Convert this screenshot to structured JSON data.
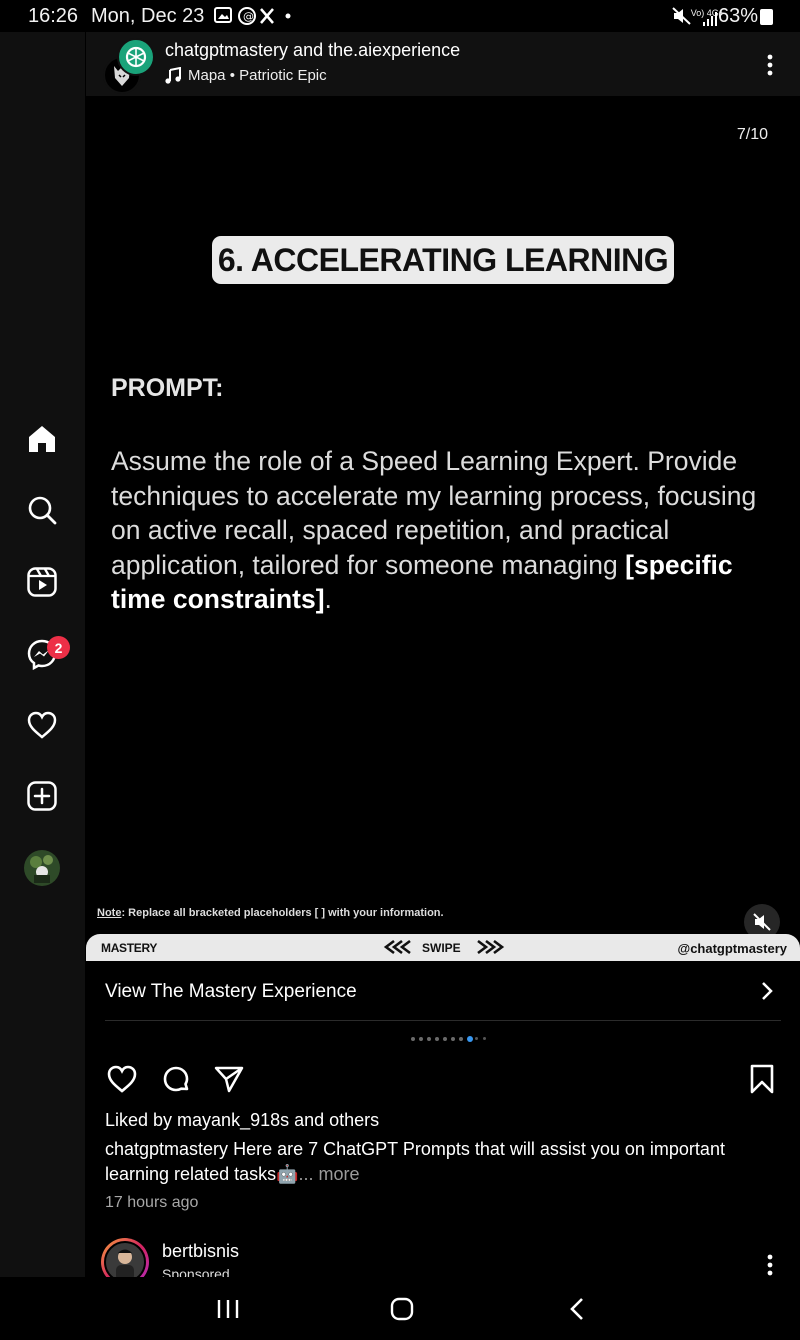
{
  "status_bar": {
    "time": "16:26",
    "date": "Mon, Dec 23",
    "network": "Vo) 4G+",
    "battery": "63%"
  },
  "left_rail": {
    "items": [
      {
        "icon": "home-icon"
      },
      {
        "icon": "search-icon"
      },
      {
        "icon": "reels-icon"
      },
      {
        "icon": "messenger-icon",
        "badge": "2"
      },
      {
        "icon": "heart-icon"
      },
      {
        "icon": "create-icon"
      },
      {
        "icon": "profile-avatar"
      }
    ]
  },
  "post": {
    "authors": "chatgptmastery and the.aiexperience",
    "music": "Mapa • Patriotic Epic",
    "slide_counter": "7/10",
    "slide": {
      "title": "6. ACCELERATING LEARNING",
      "prompt_label": "PROMPT:",
      "prompt_text": "Assume the role of a Speed Learning Expert. Provide techniques to accelerate my learning process, focusing on active recall, spaced repetition, and practical application, tailored for someone managing ",
      "prompt_bold": "[specific time constraints]",
      "prompt_end": ".",
      "note_label": "Note",
      "note_text": ": Replace all bracketed placeholders [ ] with your information.",
      "band_left": "MASTERY",
      "band_mid": "SWIPE",
      "band_right": "@chatgptmastery"
    },
    "cta_label": "View The Mastery Experience",
    "carousel": {
      "count": 10,
      "active_index": 7
    },
    "liked_by": "Liked by mayank_918s and others",
    "caption_user": "chatgptmastery",
    "caption_text": "Here are 7 ChatGPT Prompts that will assist you on important learning related tasks",
    "caption_emoji": "🤖",
    "caption_more": "... more",
    "time_ago": "17 hours ago"
  },
  "next_post": {
    "username": "bertbisnis",
    "sponsored": "Sponsored"
  },
  "colors": {
    "badge": "#ed2f47",
    "active_dot": "#3897f0",
    "title_pill": "#ebebeb"
  }
}
